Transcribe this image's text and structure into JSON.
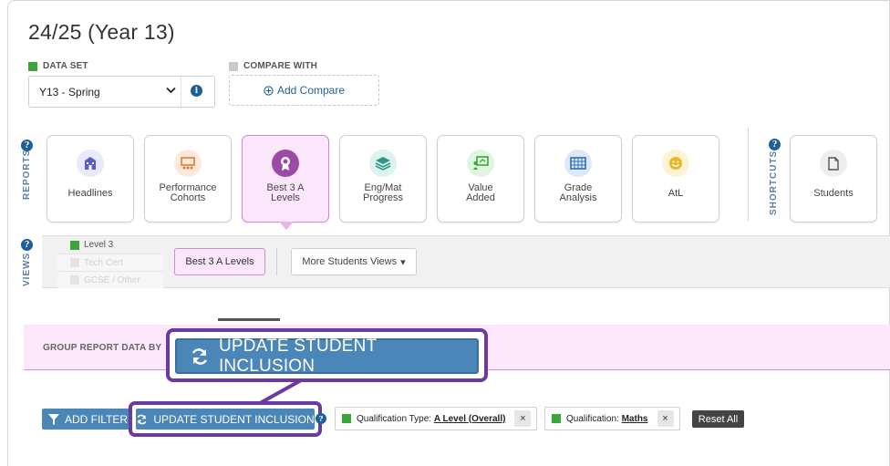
{
  "page_title": "24/25 (Year 13)",
  "dataset": {
    "label": "DATA SET",
    "value": "Y13 - Spring",
    "info": "i"
  },
  "compare": {
    "label": "COMPARE WITH",
    "button": "Add Compare"
  },
  "reports": {
    "label": "REPORTS",
    "info": "?",
    "cards": [
      {
        "line1": "Headlines",
        "line2": "",
        "icon": "school-icon",
        "color": "#5b5fc7",
        "bg": "#e9e9fb"
      },
      {
        "line1": "Performance",
        "line2": "Cohorts",
        "icon": "classroom-icon",
        "color": "#e07a3c",
        "bg": "#fde9dc"
      },
      {
        "line1": "Best 3 A",
        "line2": "Levels",
        "icon": "award-icon",
        "color": "#fff",
        "bg": "#9b4aa6"
      },
      {
        "line1": "Eng/Mat",
        "line2": "Progress",
        "icon": "layers-icon",
        "color": "#2a9a86",
        "bg": "#dcf3ee"
      },
      {
        "line1": "Value",
        "line2": "Added",
        "icon": "presentation-icon",
        "color": "#3aa63a",
        "bg": "#e1f4df"
      },
      {
        "line1": "Grade",
        "line2": "Analysis",
        "icon": "grid-icon",
        "color": "#2e6fb5",
        "bg": "#dde9f8"
      },
      {
        "line1": "AtL",
        "line2": "",
        "icon": "smiley-icon",
        "color": "#e8b828",
        "bg": "#fdf3d4"
      }
    ]
  },
  "shortcuts": {
    "label": "SHORTCUTS",
    "info": "?",
    "card": "Students",
    "icon": "document-icon"
  },
  "views": {
    "label": "VIEWS",
    "info": "?",
    "levels": [
      "Level 3",
      "Tech Cert",
      "GCSE / Other"
    ],
    "best_button": "Best 3 A Levels",
    "more_button": "More Students Views",
    "more_caret": "▾"
  },
  "group": {
    "label": "GROUP REPORT DATA BY",
    "big_button": "UPDATE STUDENT INCLUSION"
  },
  "filters": {
    "add_filter": "ADD FILTER",
    "update_button": "UPDATE STUDENT INCLUSION",
    "help": "?",
    "chips": [
      {
        "key": "Qualification Type:",
        "value": "A Level (Overall)",
        "close": "×"
      },
      {
        "key": "Qualification:",
        "value": "Maths",
        "close": "×"
      }
    ],
    "reset": "Reset All"
  },
  "colors": {
    "accent_blue": "#4a87b8",
    "highlight_purple": "#6a3aa0",
    "pink": "#fde8fb",
    "green": "#3aa63a"
  }
}
